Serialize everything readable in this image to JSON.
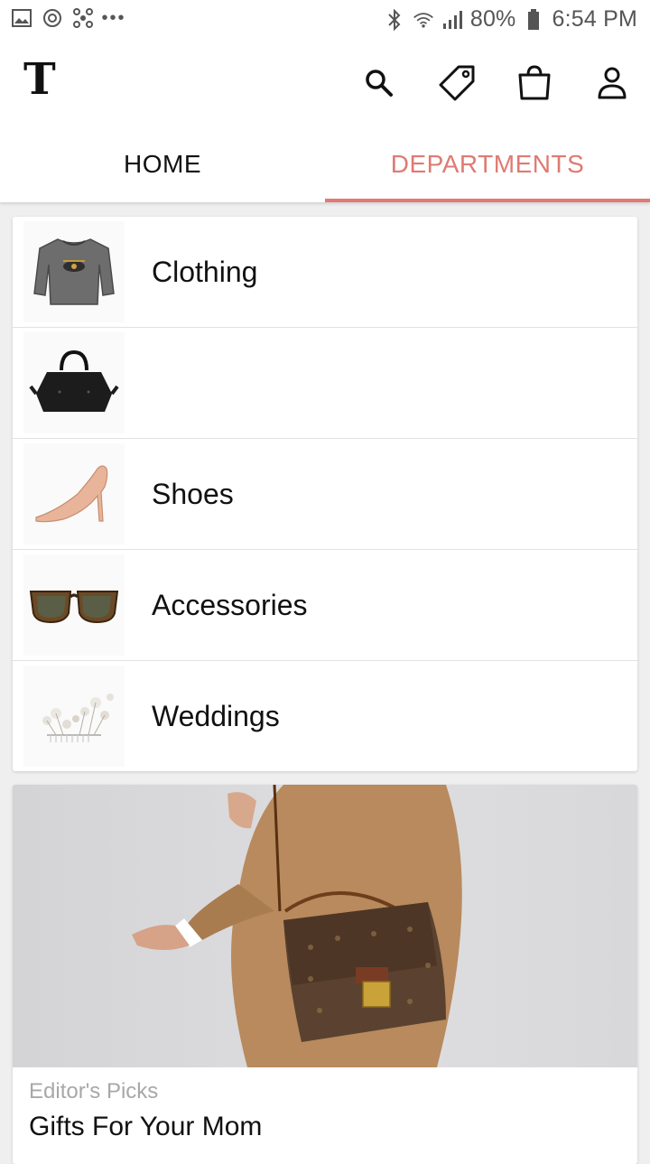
{
  "status_bar": {
    "left_icons": [
      "gallery-icon",
      "sync-icon",
      "network-icon",
      "more-dots-icon"
    ],
    "battery": "80%",
    "time": "6:54 PM"
  },
  "header": {
    "logo": "T",
    "icons": [
      "search-icon",
      "tag-icon",
      "bag-icon",
      "account-icon"
    ]
  },
  "tabs": [
    {
      "label": "HOME",
      "active": false
    },
    {
      "label": "DEPARTMENTS",
      "active": true
    }
  ],
  "accent_color": "#e07a72",
  "departments": [
    {
      "label": "Clothing",
      "thumb": "sweater-icon"
    },
    {
      "label": "",
      "thumb": "handbag-icon"
    },
    {
      "label": "Shoes",
      "thumb": "heel-icon"
    },
    {
      "label": "Accessories",
      "thumb": "sunglasses-icon"
    },
    {
      "label": "Weddings",
      "thumb": "flowers-icon"
    }
  ],
  "editor_card": {
    "kicker": "Editor's Picks",
    "title": "Gifts For Your Mom"
  }
}
